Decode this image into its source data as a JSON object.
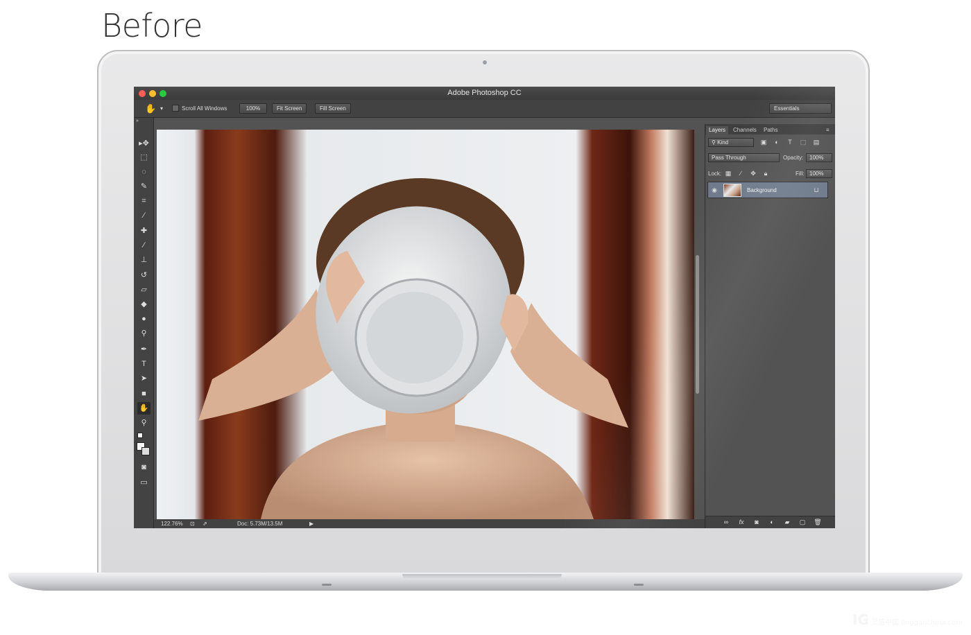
{
  "heading": "Before",
  "window": {
    "title": "Adobe Photoshop CC",
    "traffic_colors": [
      "#fc5f57",
      "#fdbc2e",
      "#29c940"
    ]
  },
  "options_bar": {
    "tool_icon": "hand-icon",
    "scroll_all_windows": "Scroll All Windows",
    "btn_100": "100%",
    "btn_fit": "Fit Screen",
    "btn_fill": "Fill Screen",
    "workspace": "Essentials"
  },
  "tools": [
    {
      "name": "move-icon",
      "glyph": "▸✥"
    },
    {
      "name": "marquee-icon",
      "glyph": "⬚"
    },
    {
      "name": "lasso-icon",
      "glyph": "◌"
    },
    {
      "name": "quick-select-icon",
      "glyph": "✎"
    },
    {
      "name": "crop-icon",
      "glyph": "⌗"
    },
    {
      "name": "eyedropper-icon",
      "glyph": "⁄"
    },
    {
      "name": "healing-icon",
      "glyph": "✚"
    },
    {
      "name": "brush-icon",
      "glyph": "∕"
    },
    {
      "name": "stamp-icon",
      "glyph": "⊥"
    },
    {
      "name": "history-brush-icon",
      "glyph": "↺"
    },
    {
      "name": "eraser-icon",
      "glyph": "▱"
    },
    {
      "name": "bucket-icon",
      "glyph": "◆"
    },
    {
      "name": "blur-icon",
      "glyph": "●"
    },
    {
      "name": "dodge-icon",
      "glyph": "⚲"
    },
    {
      "name": "pen-icon",
      "glyph": "✒"
    },
    {
      "name": "type-icon",
      "glyph": "T"
    },
    {
      "name": "path-select-icon",
      "glyph": "➤"
    },
    {
      "name": "shape-icon",
      "glyph": "■"
    },
    {
      "name": "hand-icon",
      "glyph": "✋"
    },
    {
      "name": "zoom-icon",
      "glyph": "⚲"
    }
  ],
  "status": {
    "zoom": "122.76%",
    "doc": "Doc: 5.73M/13.5M"
  },
  "panel": {
    "tabs": [
      "Layers",
      "Channels",
      "Paths"
    ],
    "filter_kind": "Kind",
    "blend_mode": "Pass Through",
    "opacity_label": "Opacity:",
    "opacity_value": "100%",
    "lock_label": "Lock:",
    "fill_label": "Fill:",
    "fill_value": "100%",
    "layer_name": "Background"
  },
  "watermark": "lingganchina.com"
}
